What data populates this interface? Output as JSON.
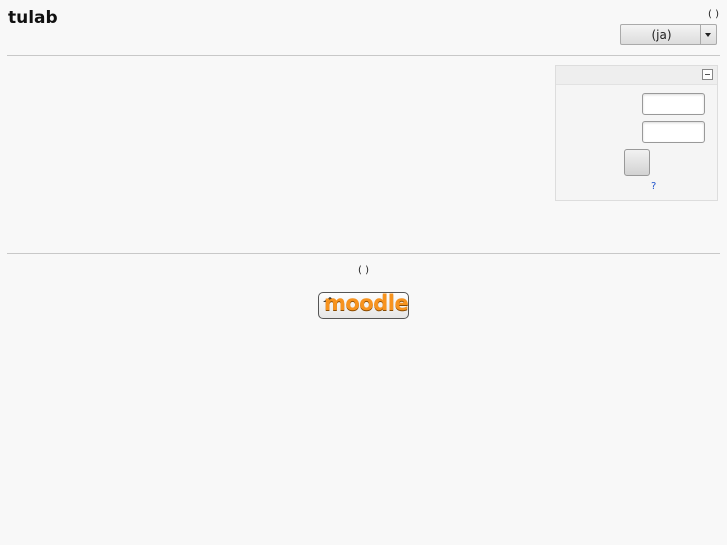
{
  "header": {
    "site_title": "tulab",
    "login_info": "(  )",
    "language": {
      "selected": "(ja)"
    }
  },
  "login_block": {
    "username": {
      "value": "",
      "placeholder": ""
    },
    "password": {
      "value": "",
      "placeholder": ""
    },
    "login_button_label": "",
    "help_link": "?"
  },
  "footer": {
    "login_info": "(  )",
    "logo_text": "moodle"
  },
  "icons": {
    "collapse": "collapse-minus-icon",
    "dropdown": "chevron-down-icon",
    "logo_cap": "mortarboard-icon"
  },
  "colors": {
    "accent_link": "#2255cc",
    "moodle_orange": "#f7931e",
    "background": "#f8f8f8"
  }
}
